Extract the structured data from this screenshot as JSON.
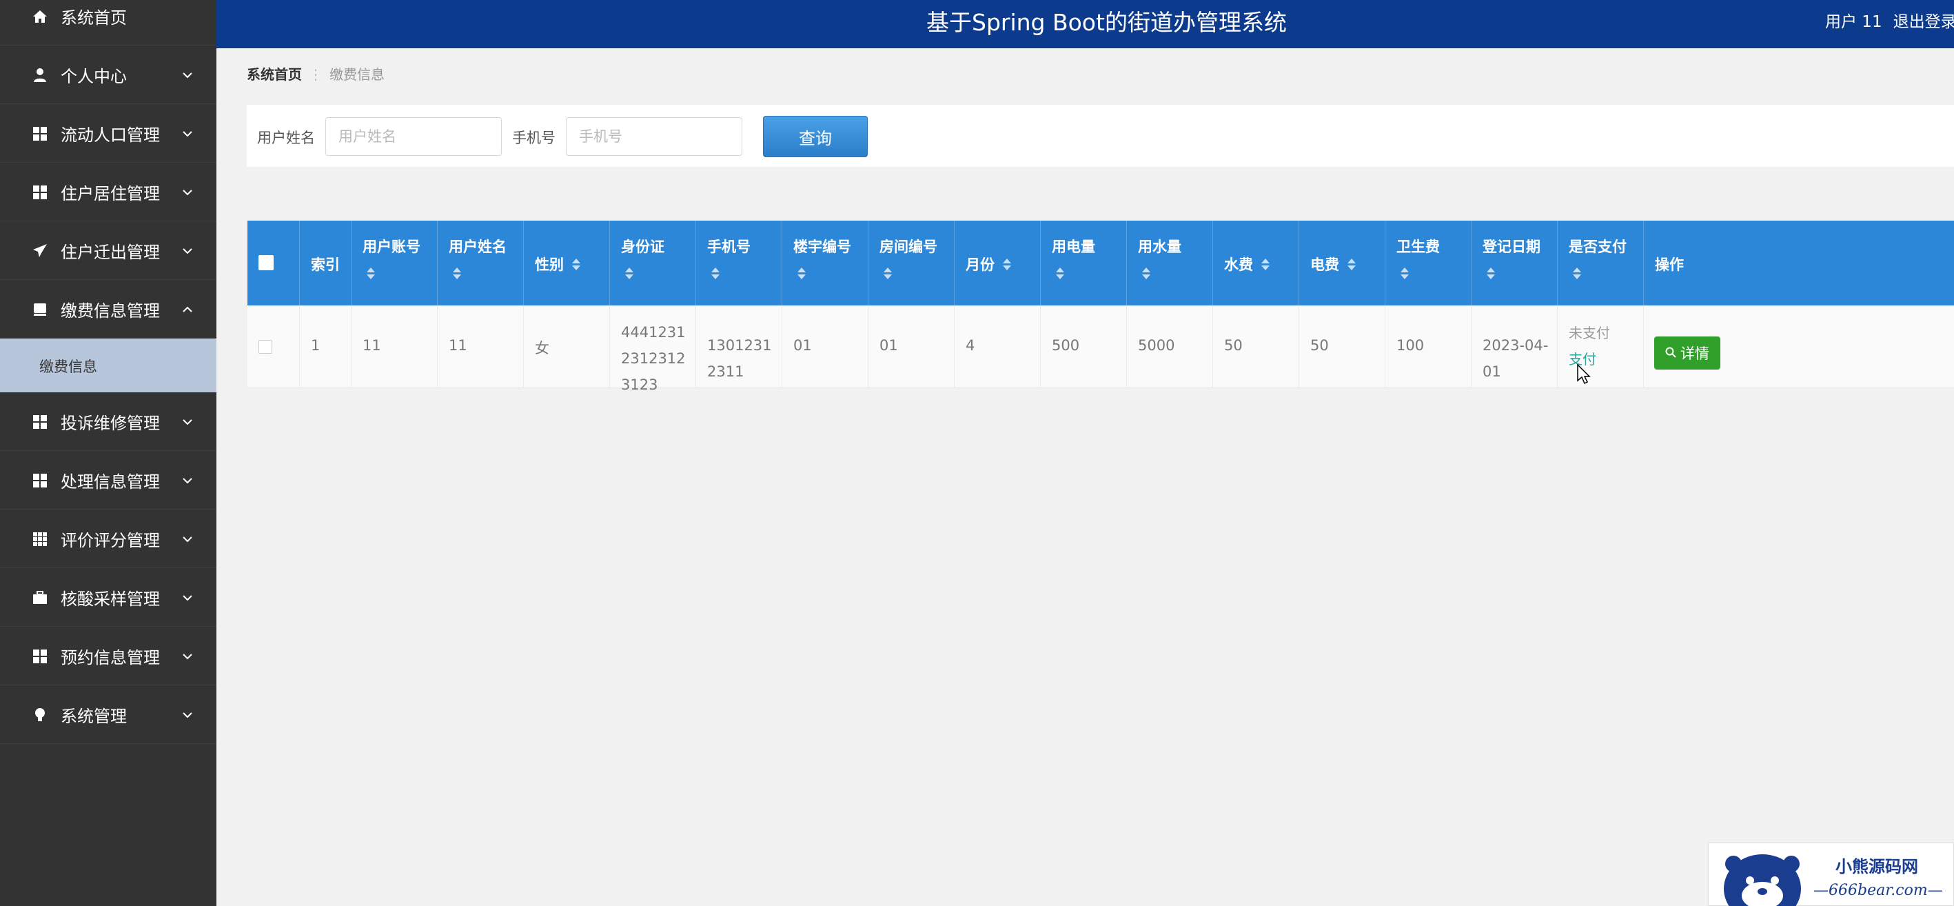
{
  "header": {
    "title": "基于Spring Boot的街道办管理系统",
    "user_label": "用户 11",
    "logout_label": "退出登录"
  },
  "sidebar": {
    "items": [
      {
        "label": "系统首页",
        "icon": "home-icon"
      },
      {
        "label": "个人中心",
        "icon": "user-icon"
      },
      {
        "label": "流动人口管理",
        "icon": "grid-icon"
      },
      {
        "label": "住户居住管理",
        "icon": "grid-icon"
      },
      {
        "label": "住户迁出管理",
        "icon": "paper-plane-icon"
      },
      {
        "label": "缴费信息管理",
        "icon": "card-icon"
      },
      {
        "label": "投诉维修管理",
        "icon": "grid-icon"
      },
      {
        "label": "处理信息管理",
        "icon": "grid-icon"
      },
      {
        "label": "评价评分管理",
        "icon": "table-icon"
      },
      {
        "label": "核酸采样管理",
        "icon": "briefcase-icon"
      },
      {
        "label": "预约信息管理",
        "icon": "grid-icon"
      },
      {
        "label": "系统管理",
        "icon": "bulb-icon"
      }
    ],
    "sub_item": "缴费信息"
  },
  "breadcrumb": {
    "home": "系统首页",
    "separator": "⋮",
    "current": "缴费信息"
  },
  "search": {
    "name_label": "用户姓名",
    "name_placeholder": "用户姓名",
    "phone_label": "手机号",
    "phone_placeholder": "手机号",
    "button": "查询"
  },
  "table": {
    "headers": [
      "索引",
      "用户账号",
      "用户姓名",
      "性别",
      "身份证",
      "手机号",
      "楼宇编号",
      "房间编号",
      "月份",
      "用电量",
      "用水量",
      "水费",
      "电费",
      "卫生费",
      "登记日期",
      "是否支付",
      "操作"
    ],
    "rows": [
      {
        "index": "1",
        "account": "11",
        "name": "11",
        "gender": "女",
        "id_card": "444123123123123123",
        "phone": "13012312311",
        "building": "01",
        "room": "01",
        "month": "4",
        "electricity": "500",
        "water": "5000",
        "water_fee": "50",
        "electric_fee": "50",
        "sanitation_fee": "100",
        "date": "2023-04-01",
        "pay_status": "未支付",
        "pay_action": "支付",
        "detail_button": "详情"
      }
    ]
  },
  "watermark": {
    "line1": "小熊源码网",
    "line2": "—666bear.com—"
  },
  "colors": {
    "sidebar_bg": "#333333",
    "header_bg": "#0c3b8e",
    "table_header_bg": "#2d87d8",
    "detail_button": "#31a02b",
    "active_sub_bg": "#b7c6db"
  }
}
